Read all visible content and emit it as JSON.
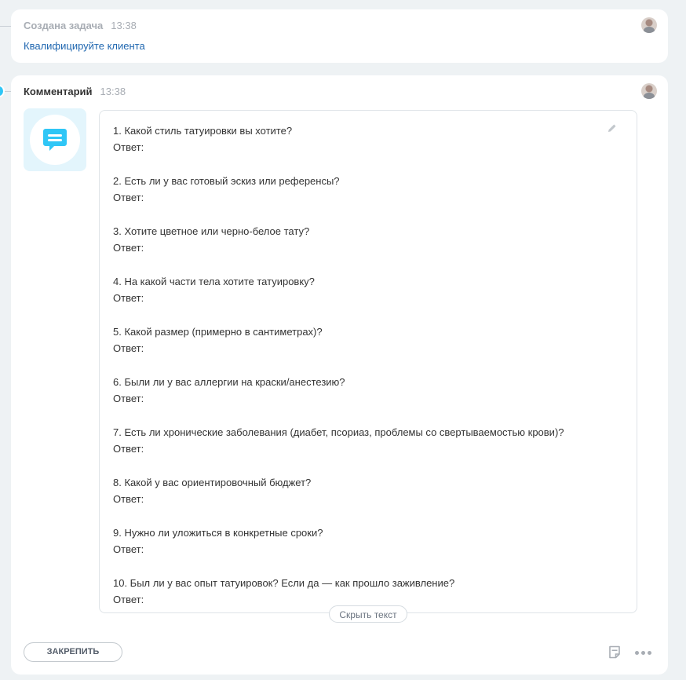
{
  "task_card": {
    "title": "Создана задача",
    "time": "13:38",
    "link": "Квалифицируйте клиента"
  },
  "comment_card": {
    "title": "Комментарий",
    "time": "13:38",
    "questions": [
      {
        "q": "1. Какой стиль татуировки вы хотите?",
        "a": "Ответ:"
      },
      {
        "q": "2. Есть ли у вас готовый эскиз или референсы?",
        "a": "Ответ:"
      },
      {
        "q": "3. Хотите цветное или черно-белое тату?",
        "a": "Ответ:"
      },
      {
        "q": "4. На какой части тела хотите татуировку?",
        "a": "Ответ:"
      },
      {
        "q": "5. Какой размер (примерно в сантиметрах)?",
        "a": "Ответ:"
      },
      {
        "q": "6. Были ли у вас аллергии на краски/анестезию?",
        "a": "Ответ:"
      },
      {
        "q": "7. Есть ли хронические заболевания (диабет, псориаз, проблемы со свертываемостью крови)?",
        "a": "Ответ:"
      },
      {
        "q": "8. Какой у вас ориентировочный бюджет?",
        "a": "Ответ:"
      },
      {
        "q": "9. Нужно ли уложиться в конкретные сроки?",
        "a": "Ответ:"
      },
      {
        "q": "10. Был ли у вас опыт татуировок? Если да — как прошло заживление?",
        "a": "Ответ:"
      }
    ],
    "hide_text_label": "Скрыть текст",
    "pin_label": "ЗАКРЕПИТЬ"
  },
  "colors": {
    "accent": "#2fc6f6",
    "link": "#2067b0",
    "background": "#eef2f4"
  },
  "icons": [
    "comment-bubble-icon",
    "edit-pencil-icon",
    "note-icon",
    "more-dots-icon",
    "user-avatar"
  ]
}
